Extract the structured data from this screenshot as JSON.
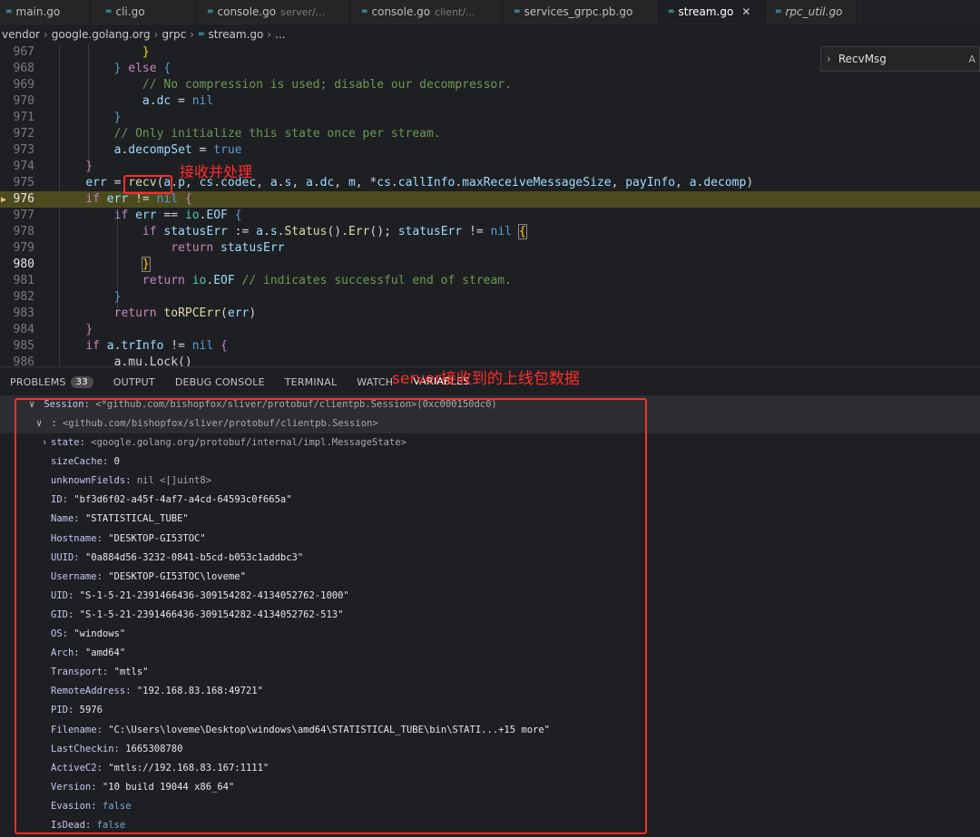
{
  "tabs": [
    {
      "name": "main.go",
      "hint": ""
    },
    {
      "name": "cli.go",
      "hint": ""
    },
    {
      "name": "console.go",
      "hint": "server/..."
    },
    {
      "name": "console.go",
      "hint": "client/..."
    },
    {
      "name": "services_grpc.pb.go",
      "hint": ""
    },
    {
      "name": "stream.go",
      "hint": "",
      "active": true
    },
    {
      "name": "rpc_util.go",
      "hint": ""
    }
  ],
  "breadcrumb": {
    "p1": "vendor",
    "p2": "google.golang.org",
    "p3": "grpc",
    "p4": "stream.go",
    "p5": "..."
  },
  "sticky": {
    "label": "RecvMsg",
    "ab": "A"
  },
  "editor_lines": [
    {
      "n": "967",
      "code": "            }"
    },
    {
      "n": "968",
      "code": "        } else {"
    },
    {
      "n": "969",
      "code": "            // No compression is used; disable our decompressor."
    },
    {
      "n": "970",
      "code": "            a.dc = nil"
    },
    {
      "n": "971",
      "code": "        }"
    },
    {
      "n": "972",
      "code": "        // Only initialize this state once per stream."
    },
    {
      "n": "973",
      "code": "        a.decompSet = true"
    },
    {
      "n": "974",
      "code": "    }"
    },
    {
      "n": "975",
      "code": "    err = recv(a.p, cs.codec, a.s, a.dc, m, *cs.callInfo.maxReceiveMessageSize, payInfo, a.decomp)"
    },
    {
      "n": "976",
      "code": "    if err != nil {"
    },
    {
      "n": "977",
      "code": "        if err == io.EOF {"
    },
    {
      "n": "978",
      "code": "            if statusErr := a.s.Status().Err(); statusErr != nil {"
    },
    {
      "n": "979",
      "code": "                return statusErr"
    },
    {
      "n": "980",
      "code": "            }"
    },
    {
      "n": "981",
      "code": "            return io.EOF // indicates successful end of stream."
    },
    {
      "n": "982",
      "code": "        }"
    },
    {
      "n": "983",
      "code": "        return toRPCErr(err)"
    },
    {
      "n": "984",
      "code": "    }"
    },
    {
      "n": "985",
      "code": "    if a.trInfo != nil {"
    },
    {
      "n": "986",
      "code": "        a.mu.Lock()"
    }
  ],
  "annotations": {
    "recv_note": "接收并处理",
    "server_note": "server接收到的上线包数据"
  },
  "panel_tabs": [
    {
      "label": "PROBLEMS",
      "badge": "33"
    },
    {
      "label": "OUTPUT"
    },
    {
      "label": "DEBUG CONSOLE"
    },
    {
      "label": "TERMINAL"
    },
    {
      "label": "WATCH"
    },
    {
      "label": "VARIABLES",
      "active": true
    }
  ],
  "variables": {
    "session": {
      "name": "Session",
      "value": "<*github.com/bishopfox/sliver/protobuf/clientpb.Session>(0xc000150dc0)"
    },
    "deref": {
      "name": "",
      "value": "<github.com/bishopfox/sliver/protobuf/clientpb.Session>"
    },
    "fields": [
      {
        "name": "state",
        "value": "<google.golang.org/protobuf/internal/impl.MessageState>",
        "kind": "type",
        "twisty": ">"
      },
      {
        "name": "sizeCache",
        "value": "0",
        "kind": "num"
      },
      {
        "name": "unknownFields",
        "value": "nil <[]uint8>",
        "kind": "type"
      },
      {
        "name": "ID",
        "value": "\"bf3d6f02-a45f-4af7-a4cd-64593c0f665a\"",
        "kind": "str"
      },
      {
        "name": "Name",
        "value": "\"STATISTICAL_TUBE\"",
        "kind": "str"
      },
      {
        "name": "Hostname",
        "value": "\"DESKTOP-GI53TOC\"",
        "kind": "str"
      },
      {
        "name": "UUID",
        "value": "\"0a884d56-3232-0841-b5cd-b053c1addbc3\"",
        "kind": "str"
      },
      {
        "name": "Username",
        "value": "\"DESKTOP-GI53TOC\\loveme\"",
        "kind": "str"
      },
      {
        "name": "UID",
        "value": "\"S-1-5-21-2391466436-309154282-4134052762-1000\"",
        "kind": "str"
      },
      {
        "name": "GID",
        "value": "\"S-1-5-21-2391466436-309154282-4134052762-513\"",
        "kind": "str"
      },
      {
        "name": "OS",
        "value": "\"windows\"",
        "kind": "str"
      },
      {
        "name": "Arch",
        "value": "\"amd64\"",
        "kind": "str"
      },
      {
        "name": "Transport",
        "value": "\"mtls\"",
        "kind": "str"
      },
      {
        "name": "RemoteAddress",
        "value": "\"192.168.83.168:49721\"",
        "kind": "str"
      },
      {
        "name": "PID",
        "value": "5976",
        "kind": "num"
      },
      {
        "name": "Filename",
        "value": "\"C:\\Users\\loveme\\Desktop\\windows\\amd64\\STATISTICAL_TUBE\\bin\\STATI...+15 more\"",
        "kind": "str"
      },
      {
        "name": "LastCheckin",
        "value": "1665308780",
        "kind": "num"
      },
      {
        "name": "ActiveC2",
        "value": "\"mtls://192.168.83.167:1111\"",
        "kind": "str"
      },
      {
        "name": "Version",
        "value": "\"10 build 19044 x86_64\"",
        "kind": "str"
      },
      {
        "name": "Evasion",
        "value": "false",
        "kind": "bool"
      },
      {
        "name": "IsDead",
        "value": "false",
        "kind": "bool"
      }
    ]
  }
}
